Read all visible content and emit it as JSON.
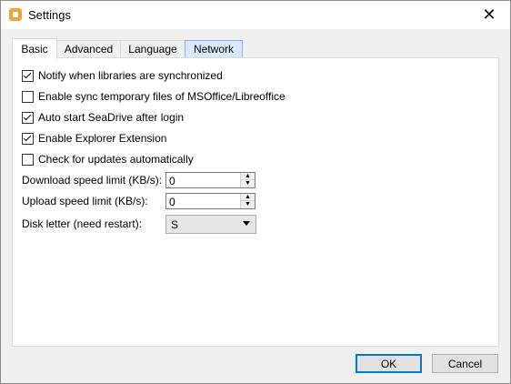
{
  "window": {
    "title": "Settings"
  },
  "tabs": [
    {
      "label": "Basic"
    },
    {
      "label": "Advanced"
    },
    {
      "label": "Language"
    },
    {
      "label": "Network"
    }
  ],
  "options": [
    {
      "label": "Notify when libraries are synchronized",
      "checked": true
    },
    {
      "label": "Enable sync temporary files of MSOffice/Libreoffice",
      "checked": false
    },
    {
      "label": "Auto start SeaDrive after login",
      "checked": true
    },
    {
      "label": "Enable Explorer Extension",
      "checked": true
    },
    {
      "label": "Check for updates automatically",
      "checked": false
    }
  ],
  "download_limit": {
    "label": "Download speed limit (KB/s):",
    "value": "0"
  },
  "upload_limit": {
    "label": "Upload speed limit (KB/s):",
    "value": "0"
  },
  "disk_letter": {
    "label": "Disk letter (need restart):",
    "value": "S"
  },
  "buttons": {
    "ok": "OK",
    "cancel": "Cancel"
  }
}
